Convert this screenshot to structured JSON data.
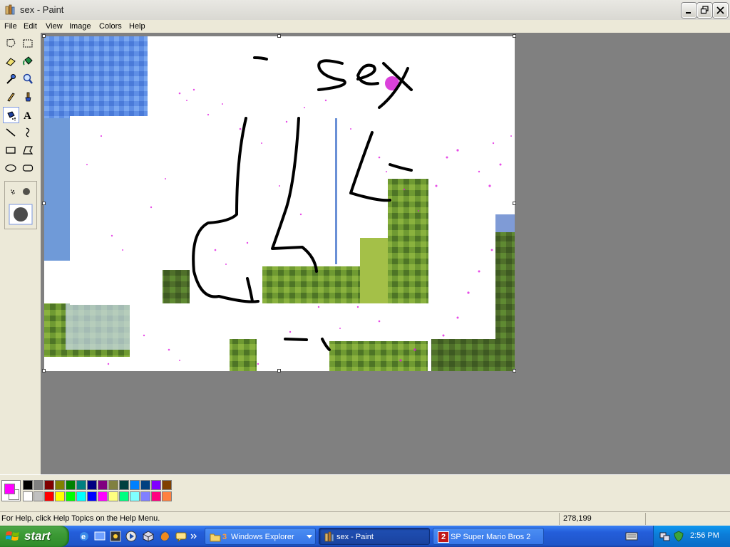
{
  "window": {
    "title": "sex - Paint"
  },
  "menu": [
    "File",
    "Edit",
    "View",
    "Image",
    "Colors",
    "Help"
  ],
  "tools": [
    {
      "name": "free-form-select-tool-icon"
    },
    {
      "name": "rect-select-tool-icon"
    },
    {
      "name": "eraser-tool-icon"
    },
    {
      "name": "fill-tool-icon"
    },
    {
      "name": "pick-color-tool-icon"
    },
    {
      "name": "magnifier-tool-icon"
    },
    {
      "name": "pencil-tool-icon"
    },
    {
      "name": "brush-tool-icon"
    },
    {
      "name": "airbrush-tool-icon"
    },
    {
      "name": "text-tool-icon",
      "glyph": "A"
    },
    {
      "name": "line-tool-icon"
    },
    {
      "name": "curve-tool-icon"
    },
    {
      "name": "rectangle-tool-icon"
    },
    {
      "name": "polygon-tool-icon"
    },
    {
      "name": "ellipse-tool-icon"
    },
    {
      "name": "rounded-rect-tool-icon"
    }
  ],
  "canvas": {
    "drawn_text": "sex"
  },
  "palette": {
    "foreground": "#ff00ff",
    "background": "#ffffff",
    "row1": [
      "#000000",
      "#808080",
      "#800000",
      "#808000",
      "#008000",
      "#008080",
      "#000080",
      "#800080",
      "#808040",
      "#004040",
      "#0080ff",
      "#004080",
      "#8000ff",
      "#804000"
    ],
    "row2": [
      "#ffffff",
      "#c0c0c0",
      "#ff0000",
      "#ffff00",
      "#00ff00",
      "#00ffff",
      "#0000ff",
      "#ff00ff",
      "#ffff80",
      "#00ff80",
      "#80ffff",
      "#8080ff",
      "#ff0080",
      "#ff8040"
    ]
  },
  "status": {
    "help_text": "For Help, click Help Topics on the Help Menu.",
    "coords": "278,199"
  },
  "taskbar": {
    "start_label": "start",
    "items": [
      {
        "badge": "3",
        "label": "Windows Explorer"
      },
      {
        "label": "sex - Paint"
      },
      {
        "badge": "2",
        "label": "SP Super Mario Bros 2"
      }
    ],
    "clock": "2:56 PM"
  }
}
